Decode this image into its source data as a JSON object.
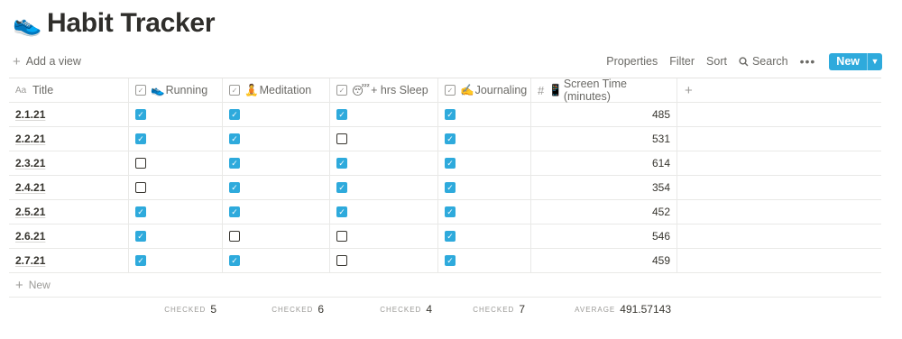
{
  "page": {
    "icon": "running-shoe-icon",
    "icon_glyph": "👟",
    "title": "Habit Tracker"
  },
  "toolbar": {
    "add_view": "Add a view",
    "properties": "Properties",
    "filter": "Filter",
    "sort": "Sort",
    "search": "Search",
    "more": "•••",
    "new": "New"
  },
  "columns": [
    {
      "name": "Title",
      "icon": "text-aa-icon"
    },
    {
      "name": "Running",
      "emoji": "👟",
      "icon": "checkbox-property-icon"
    },
    {
      "name": "Meditation",
      "emoji": "🧘",
      "icon": "checkbox-property-icon"
    },
    {
      "name": "+ hrs Sleep",
      "emoji": "😴",
      "icon": "checkbox-property-icon"
    },
    {
      "name": "Journaling",
      "emoji": "✍️",
      "icon": "checkbox-property-icon"
    },
    {
      "name": "Screen Time (minutes)",
      "emoji": "📱",
      "icon": "number-hash-icon"
    }
  ],
  "rows": [
    {
      "title": "2.1.21",
      "running": true,
      "meditation": true,
      "sleep": true,
      "journaling": true,
      "screen": "485"
    },
    {
      "title": "2.2.21",
      "running": true,
      "meditation": true,
      "sleep": false,
      "journaling": true,
      "screen": "531"
    },
    {
      "title": "2.3.21",
      "running": false,
      "meditation": true,
      "sleep": true,
      "journaling": true,
      "screen": "614"
    },
    {
      "title": "2.4.21",
      "running": false,
      "meditation": true,
      "sleep": true,
      "journaling": true,
      "screen": "354"
    },
    {
      "title": "2.5.21",
      "running": true,
      "meditation": true,
      "sleep": true,
      "journaling": true,
      "screen": "452"
    },
    {
      "title": "2.6.21",
      "running": true,
      "meditation": false,
      "sleep": false,
      "journaling": true,
      "screen": "546"
    },
    {
      "title": "2.7.21",
      "running": true,
      "meditation": true,
      "sleep": false,
      "journaling": true,
      "screen": "459"
    }
  ],
  "new_row": "New",
  "calculations": {
    "running": {
      "label": "CHECKED",
      "value": "5"
    },
    "meditation": {
      "label": "CHECKED",
      "value": "6"
    },
    "sleep": {
      "label": "CHECKED",
      "value": "4"
    },
    "journaling": {
      "label": "CHECKED",
      "value": "7"
    },
    "screen": {
      "label": "AVERAGE",
      "value": "491.57143"
    }
  },
  "colors": {
    "accent": "#2eaadc",
    "text": "#37352f",
    "muted": "#9b9a97",
    "border": "#e9e9e7"
  }
}
